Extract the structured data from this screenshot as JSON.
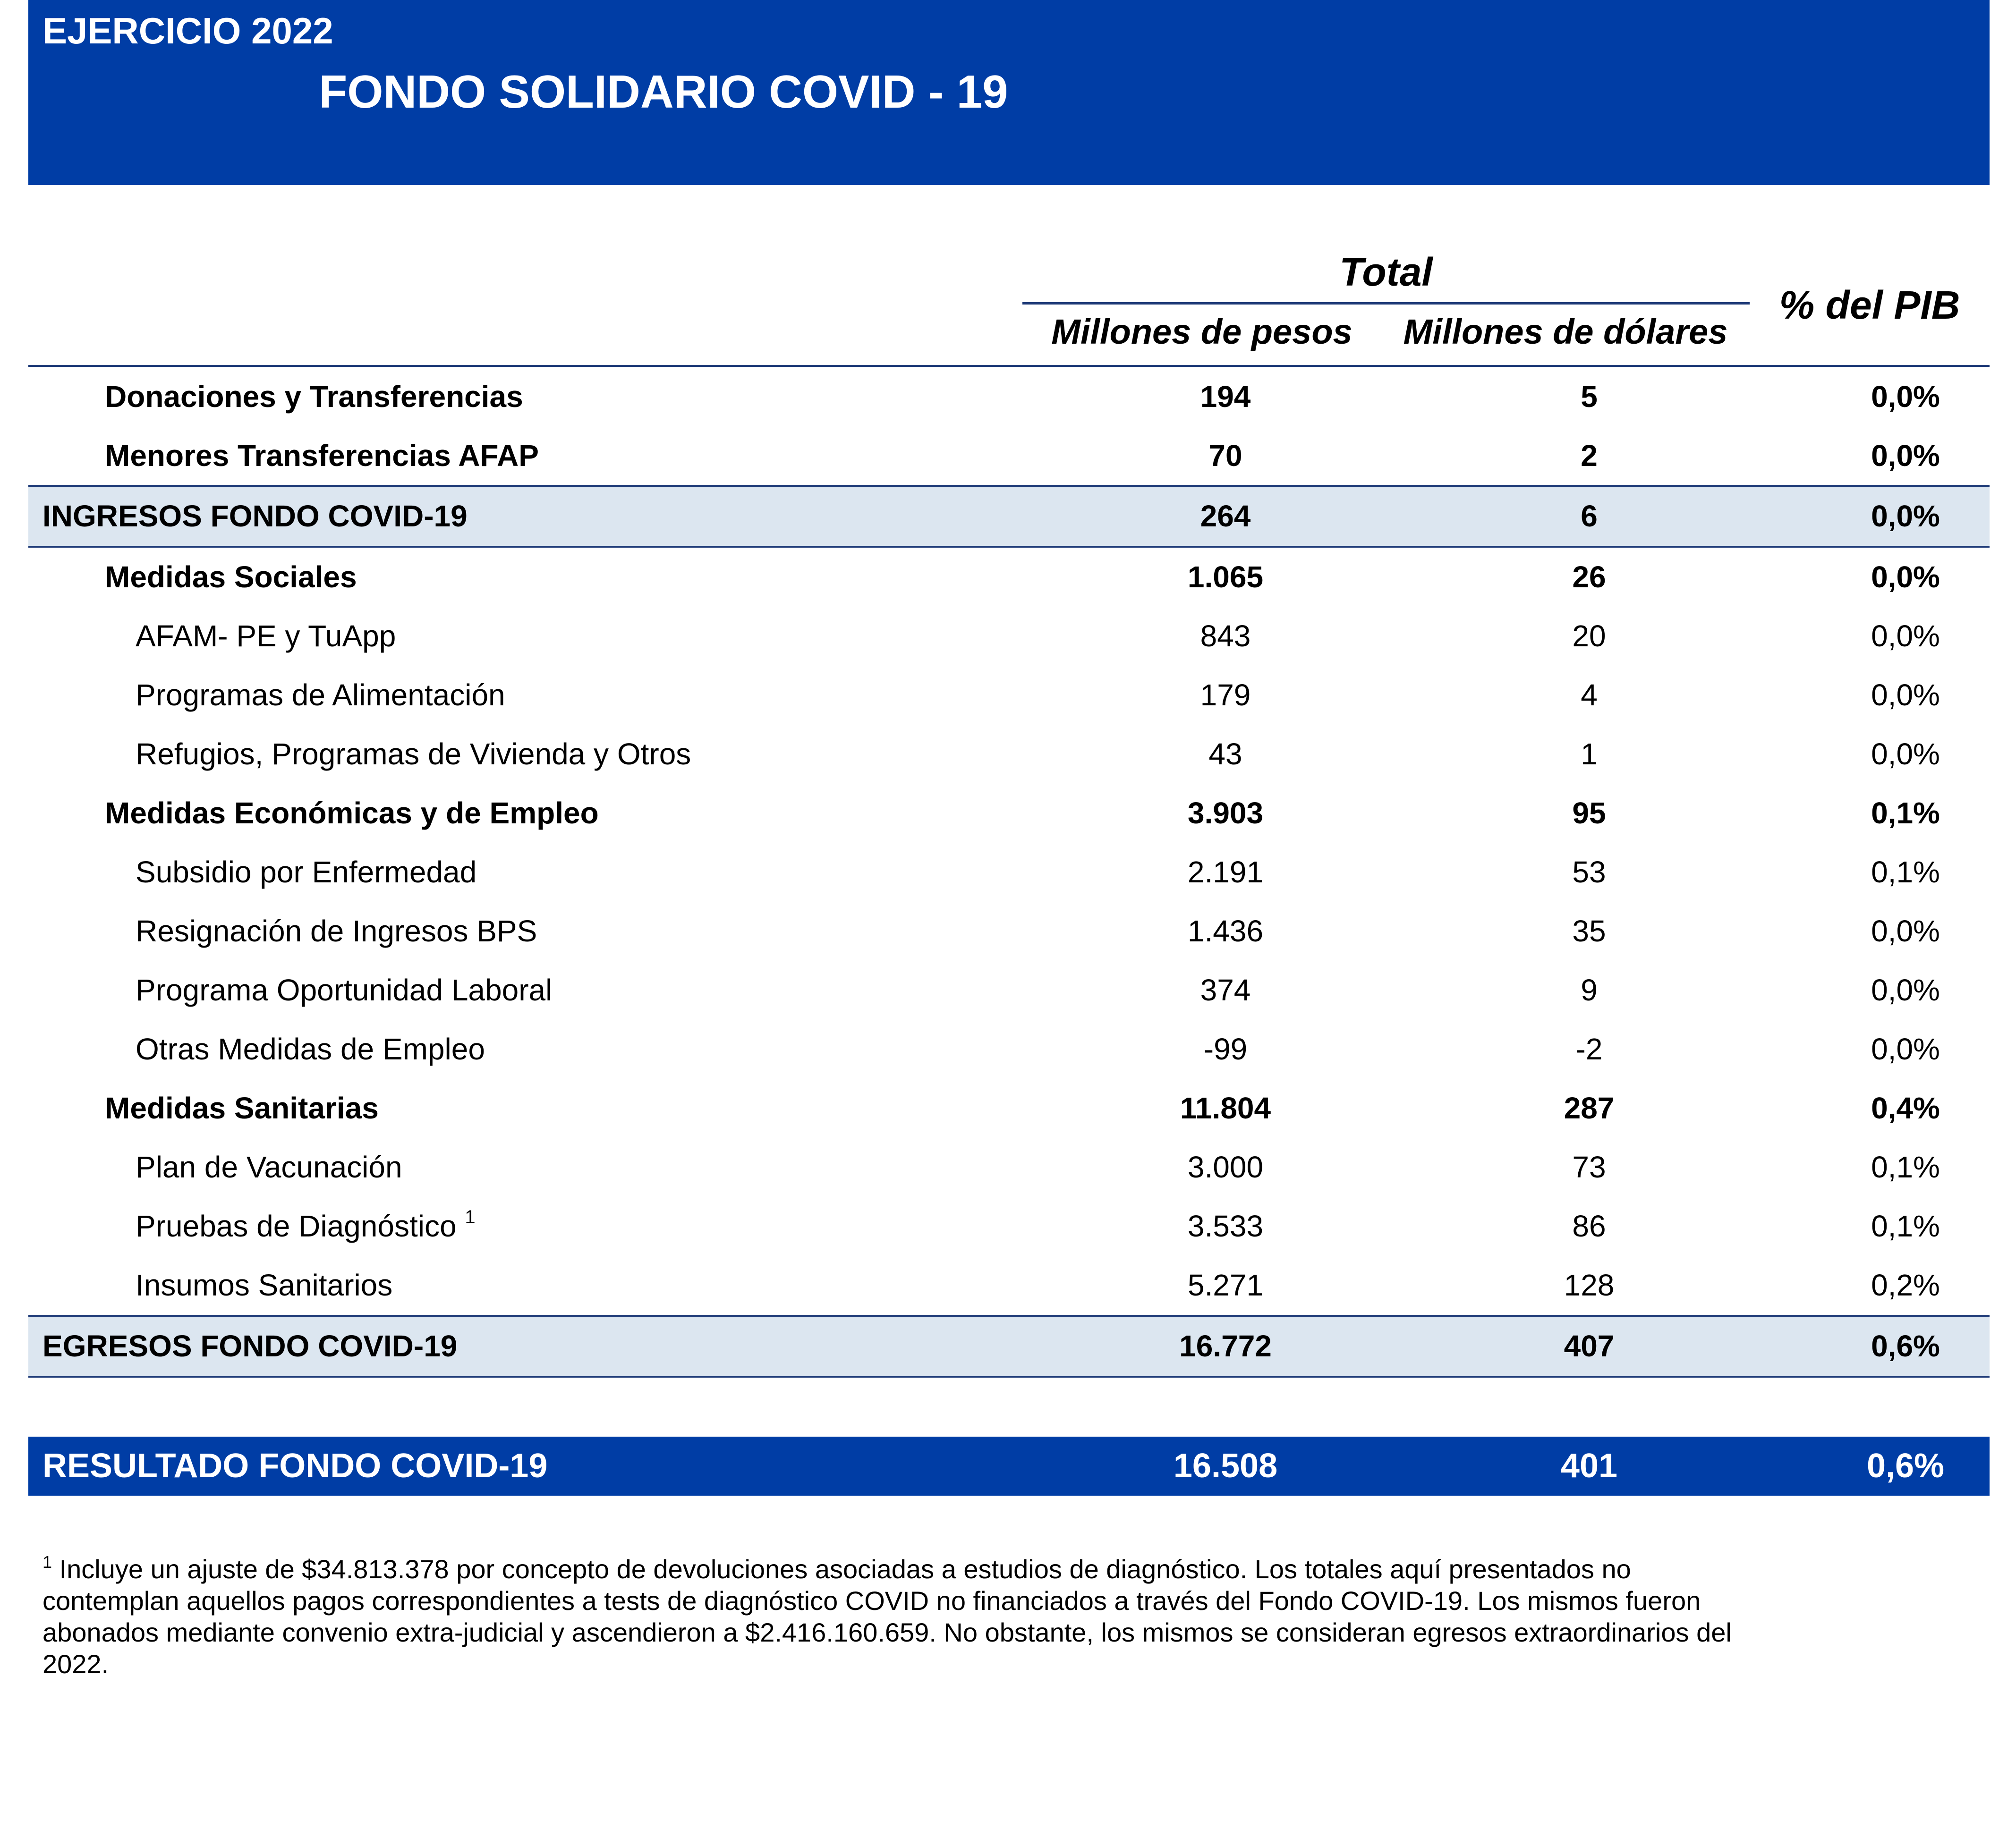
{
  "header": {
    "year": "EJERCICIO 2022",
    "title": "FONDO SOLIDARIO COVID - 19"
  },
  "columns": {
    "total": "Total",
    "pesos": "Millones de pesos",
    "dolares": "Millones de dólares",
    "pib": "% del PIB"
  },
  "rows": [
    {
      "label": "Donaciones y Transferencias",
      "pesos": "194",
      "dolares": "5",
      "pib": "0,0%"
    },
    {
      "label": "Menores Transferencias AFAP",
      "pesos": "70",
      "dolares": "2",
      "pib": "0,0%"
    },
    {
      "label": "INGRESOS FONDO COVID-19",
      "pesos": "264",
      "dolares": "6",
      "pib": "0,0%"
    },
    {
      "label": "Medidas Sociales",
      "pesos": "1.065",
      "dolares": "26",
      "pib": "0,0%"
    },
    {
      "label": "AFAM- PE y TuApp",
      "pesos": "843",
      "dolares": "20",
      "pib": "0,0%"
    },
    {
      "label": "Programas de Alimentación",
      "pesos": "179",
      "dolares": "4",
      "pib": "0,0%"
    },
    {
      "label": "Refugios, Programas de Vivienda y Otros",
      "pesos": "43",
      "dolares": "1",
      "pib": "0,0%"
    },
    {
      "label": "Medidas Económicas y de Empleo",
      "pesos": "3.903",
      "dolares": "95",
      "pib": "0,1%"
    },
    {
      "label": "Subsidio por Enfermedad",
      "pesos": "2.191",
      "dolares": "53",
      "pib": "0,1%"
    },
    {
      "label": "Resignación de Ingresos BPS",
      "pesos": "1.436",
      "dolares": "35",
      "pib": "0,0%"
    },
    {
      "label": "Programa Oportunidad Laboral",
      "pesos": "374",
      "dolares": "9",
      "pib": "0,0%"
    },
    {
      "label": "Otras Medidas de Empleo",
      "pesos": "-99",
      "dolares": "-2",
      "pib": "0,0%"
    },
    {
      "label": "Medidas Sanitarias",
      "pesos": "11.804",
      "dolares": "287",
      "pib": "0,4%"
    },
    {
      "label": "Plan de Vacunación",
      "pesos": "3.000",
      "dolares": "73",
      "pib": "0,1%"
    },
    {
      "label": "Pruebas de Diagnóstico",
      "sup": "1",
      "pesos": "3.533",
      "dolares": "86",
      "pib": "0,1%"
    },
    {
      "label": "Insumos Sanitarios",
      "pesos": "5.271",
      "dolares": "128",
      "pib": "0,2%"
    },
    {
      "label": "EGRESOS FONDO COVID-19",
      "pesos": "16.772",
      "dolares": "407",
      "pib": "0,6%"
    },
    {
      "label": "RESULTADO FONDO COVID-19",
      "pesos": "16.508",
      "dolares": "401",
      "pib": "0,6%"
    }
  ],
  "footnote": {
    "marker": "1",
    "text": "Incluye un ajuste de $34.813.378 por concepto de devoluciones asociadas a estudios de diagnóstico. Los totales aquí presentados no contemplan aquellos pagos correspondientes a tests de diagnóstico COVID no financiados a través del Fondo COVID-19. Los mismos fueron abonados mediante convenio extra-judicial y ascendieron a $2.416.160.659. No obstante, los mismos se consideran egresos extraordinarios del 2022."
  },
  "colors": {
    "header_blue": "#003da5",
    "shade": "#dce6f0",
    "rule": "#1f3b78"
  }
}
